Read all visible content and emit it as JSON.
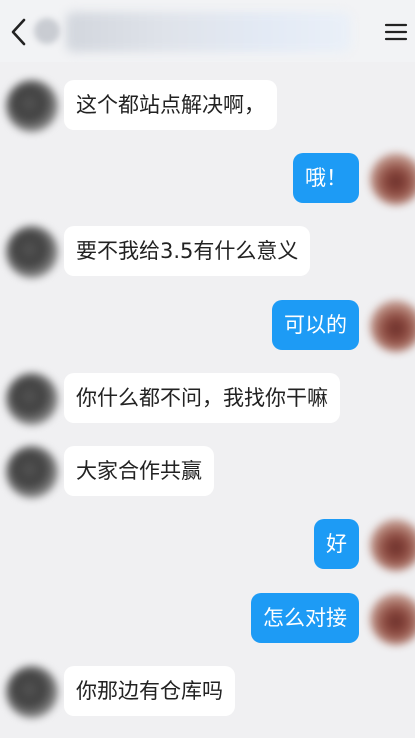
{
  "header": {
    "back_icon": "chevron-left-icon",
    "contact_name": "",
    "menu_icon": "menu-icon"
  },
  "messages": [
    {
      "side": "left",
      "text": "这个都站点解决啊，"
    },
    {
      "side": "right",
      "text": "哦！"
    },
    {
      "side": "left",
      "text": "要不我给3.5有什么意义"
    },
    {
      "side": "right",
      "text": "可以的"
    },
    {
      "side": "left",
      "text": "你什么都不问，我找你干嘛"
    },
    {
      "side": "left",
      "text": "大家合作共赢"
    },
    {
      "side": "right",
      "text": "好"
    },
    {
      "side": "right",
      "text": "怎么对接"
    },
    {
      "side": "left",
      "text": "你那边有仓库吗"
    }
  ],
  "colors": {
    "background": "#f0f0f2",
    "bubble_left": "#ffffff",
    "bubble_right": "#1d9bf5",
    "text_left": "#222222",
    "text_right": "#ffffff"
  }
}
